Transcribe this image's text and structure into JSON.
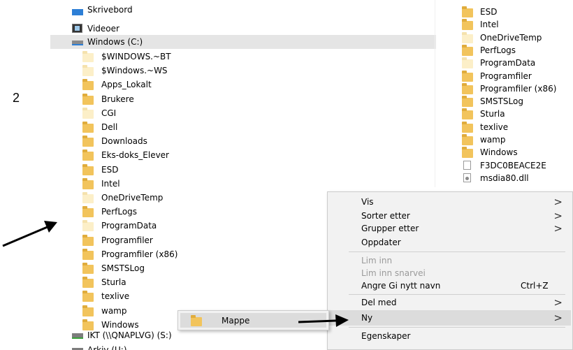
{
  "annotation": {
    "step_number": "2"
  },
  "tree": {
    "top_items": [
      {
        "label": "Skrivebord",
        "icon": "desktop-icon"
      },
      {
        "label": "Videoer",
        "icon": "video-icon"
      },
      {
        "label": "Windows (C:)",
        "icon": "drive-icon"
      }
    ],
    "folders": [
      {
        "label": "$WINDOWS.~BT",
        "icon": "folder-icon-hidden"
      },
      {
        "label": "$Windows.~WS",
        "icon": "folder-icon-hidden"
      },
      {
        "label": "Apps_Lokalt",
        "icon": "folder-icon"
      },
      {
        "label": "Brukere",
        "icon": "folder-icon"
      },
      {
        "label": "CGI",
        "icon": "folder-icon-hidden"
      },
      {
        "label": "Dell",
        "icon": "folder-icon"
      },
      {
        "label": "Downloads",
        "icon": "folder-icon"
      },
      {
        "label": "Eks-doks_Elever",
        "icon": "folder-icon"
      },
      {
        "label": "ESD",
        "icon": "folder-icon"
      },
      {
        "label": "Intel",
        "icon": "folder-icon"
      },
      {
        "label": "OneDriveTemp",
        "icon": "folder-icon-hidden"
      },
      {
        "label": "PerfLogs",
        "icon": "folder-icon"
      },
      {
        "label": "ProgramData",
        "icon": "folder-icon-hidden"
      },
      {
        "label": "Programfiler",
        "icon": "folder-icon"
      },
      {
        "label": "Programfiler (x86)",
        "icon": "folder-icon"
      },
      {
        "label": "SMSTSLog",
        "icon": "folder-icon"
      },
      {
        "label": "Sturla",
        "icon": "folder-icon"
      },
      {
        "label": "texlive",
        "icon": "folder-icon"
      },
      {
        "label": "wamp",
        "icon": "folder-icon"
      },
      {
        "label": "Windows",
        "icon": "folder-icon"
      }
    ],
    "bottom_items": [
      {
        "label": "IKT (\\\\QNAPLVG) (S:)",
        "icon": "network-drive-icon"
      },
      {
        "label": "Arkiv (U:)",
        "icon": "network-drive-icon"
      }
    ]
  },
  "content": {
    "items": [
      {
        "label": "ESD",
        "icon": "folder-icon"
      },
      {
        "label": "Intel",
        "icon": "folder-icon"
      },
      {
        "label": "OneDriveTemp",
        "icon": "folder-icon-hidden"
      },
      {
        "label": "PerfLogs",
        "icon": "folder-icon"
      },
      {
        "label": "ProgramData",
        "icon": "folder-icon-hidden"
      },
      {
        "label": "Programfiler",
        "icon": "folder-icon"
      },
      {
        "label": "Programfiler (x86)",
        "icon": "folder-icon"
      },
      {
        "label": "SMSTSLog",
        "icon": "folder-icon"
      },
      {
        "label": "Sturla",
        "icon": "folder-icon"
      },
      {
        "label": "texlive",
        "icon": "folder-icon"
      },
      {
        "label": "wamp",
        "icon": "folder-icon"
      },
      {
        "label": "Windows",
        "icon": "folder-icon"
      },
      {
        "label": "F3DC0BEACE2E",
        "icon": "file-icon"
      },
      {
        "label": "msdia80.dll",
        "icon": "dll-file-icon"
      }
    ]
  },
  "context_menu": {
    "view": {
      "label": "Vis",
      "arrow": ">"
    },
    "sort": {
      "label": "Sorter etter",
      "arrow": ">"
    },
    "group": {
      "label": "Grupper etter",
      "arrow": ">"
    },
    "refresh": {
      "label": "Oppdater"
    },
    "paste": {
      "label": "Lim inn"
    },
    "paste_shortcut": {
      "label": "Lim inn snarvei"
    },
    "undo_rename": {
      "label": "Angre Gi nytt navn",
      "shortcut": "Ctrl+Z"
    },
    "share": {
      "label": "Del med",
      "arrow": ">"
    },
    "new": {
      "label": "Ny",
      "arrow": ">"
    },
    "properties": {
      "label": "Egenskaper"
    }
  },
  "submenu": {
    "folder": {
      "label": "Mappe",
      "icon": "folder-icon"
    }
  },
  "colors": {
    "folder": "#f2c45c",
    "folder_hidden": "#fcefc8",
    "selection": "#e5e5e5",
    "menu_bg": "#f2f2f2"
  }
}
